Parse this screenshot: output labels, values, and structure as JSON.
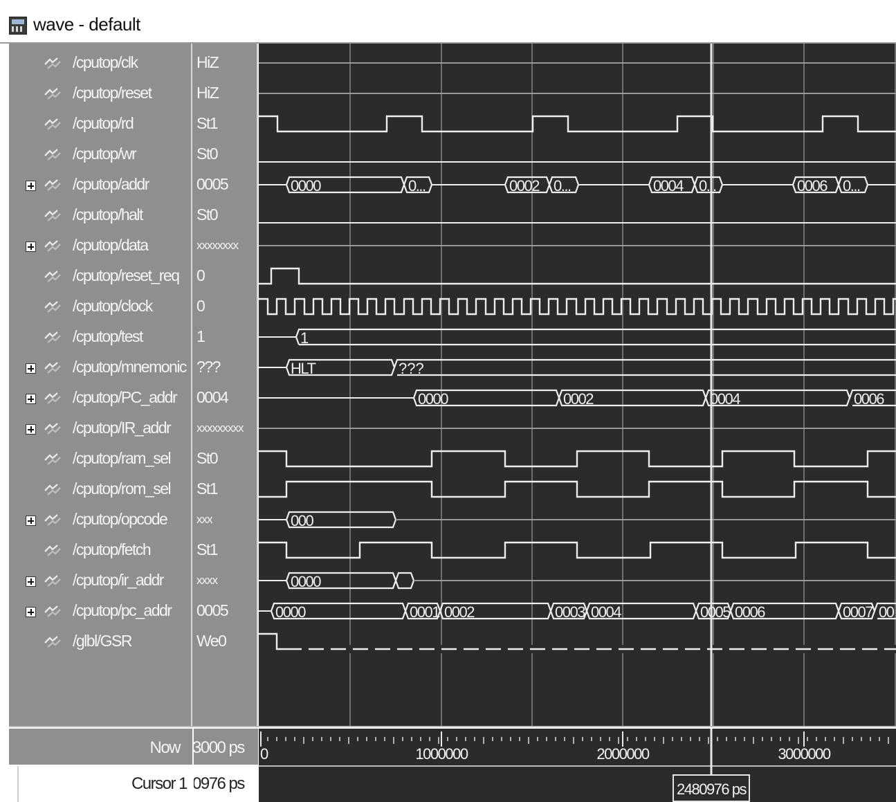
{
  "window": {
    "title": "wave - default"
  },
  "colors": {
    "pane": "#8f8f8f",
    "wave_bg": "#2b2b2b",
    "trace": "#eeeeee",
    "grid": "#6f6f6f",
    "cursor": "#e6e6e6"
  },
  "signals": [
    {
      "name": "/cputop/clk",
      "value": "HiZ",
      "expandable": false
    },
    {
      "name": "/cputop/reset",
      "value": "HiZ",
      "expandable": false
    },
    {
      "name": "/cputop/rd",
      "value": "St1",
      "expandable": false
    },
    {
      "name": "/cputop/wr",
      "value": "St0",
      "expandable": false
    },
    {
      "name": "/cputop/addr",
      "value": "0005",
      "expandable": true
    },
    {
      "name": "/cputop/halt",
      "value": "St0",
      "expandable": false
    },
    {
      "name": "/cputop/data",
      "value": "xxxxxxxx",
      "expandable": true
    },
    {
      "name": "/cputop/reset_req",
      "value": "0",
      "expandable": false
    },
    {
      "name": "/cputop/clock",
      "value": "0",
      "expandable": false
    },
    {
      "name": "/cputop/test",
      "value": "1",
      "expandable": false
    },
    {
      "name": "/cputop/mnemonic",
      "value": "???",
      "expandable": true
    },
    {
      "name": "/cputop/PC_addr",
      "value": "0004",
      "expandable": true
    },
    {
      "name": "/cputop/IR_addr",
      "value": "xxxxxxxxx",
      "expandable": true
    },
    {
      "name": "/cputop/ram_sel",
      "value": "St0",
      "expandable": false
    },
    {
      "name": "/cputop/rom_sel",
      "value": "St1",
      "expandable": false
    },
    {
      "name": "/cputop/opcode",
      "value": "xxx",
      "expandable": true
    },
    {
      "name": "/cputop/fetch",
      "value": "St1",
      "expandable": false
    },
    {
      "name": "/cputop/ir_addr",
      "value": "xxxx",
      "expandable": true
    },
    {
      "name": "/cputop/pc_addr",
      "value": "0005",
      "expandable": true
    },
    {
      "name": "/glbl/GSR",
      "value": "We0",
      "expandable": false
    }
  ],
  "bus_labels": {
    "addr": [
      "0000",
      "0...",
      "0002",
      "0...",
      "0004",
      "0...",
      "0006",
      "0..."
    ],
    "test": "1",
    "mnemonic": [
      "HLT",
      "???"
    ],
    "pc_addr_upper": [
      "0000",
      "0002",
      "0004",
      "0006"
    ],
    "opcode": "000",
    "ir_addr": "0000",
    "pc_addr_lower": [
      "0000",
      "0001",
      "0002",
      "0003",
      "0004",
      "0005",
      "0006",
      "0007",
      "00"
    ]
  },
  "status": {
    "now_label": "Now",
    "now_value": "3000 ps",
    "cursor_label": "Cursor 1",
    "cursor_value": "0976 ps"
  },
  "timeline": {
    "ticks": [
      "0",
      "1000000",
      "2000000",
      "3000000"
    ],
    "cursor_readout": "2480976 ps"
  }
}
